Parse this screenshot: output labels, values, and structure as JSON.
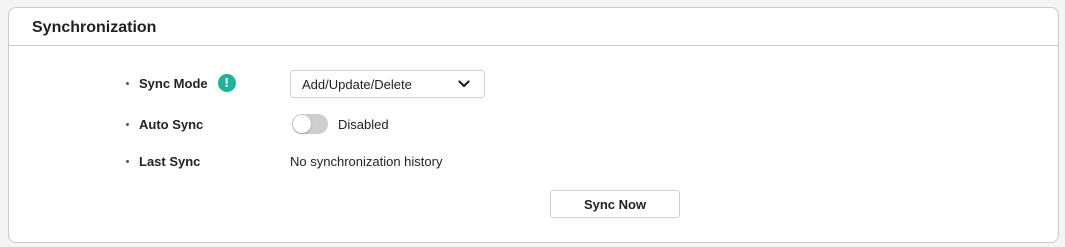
{
  "section": {
    "title": "Synchronization"
  },
  "fields": {
    "sync_mode": {
      "label": "Sync Mode",
      "info_icon": "exclamation-info-icon",
      "info_glyph": "!",
      "selected": "Add/Update/Delete"
    },
    "auto_sync": {
      "label": "Auto Sync",
      "enabled": false,
      "status_text": "Disabled"
    },
    "last_sync": {
      "label": "Last Sync",
      "value": "No synchronization history"
    }
  },
  "actions": {
    "sync_now_label": "Sync Now"
  },
  "colors": {
    "info_badge": "#1bb59b",
    "toggle_off": "#cfcfd2",
    "border": "#c9c9cc"
  }
}
